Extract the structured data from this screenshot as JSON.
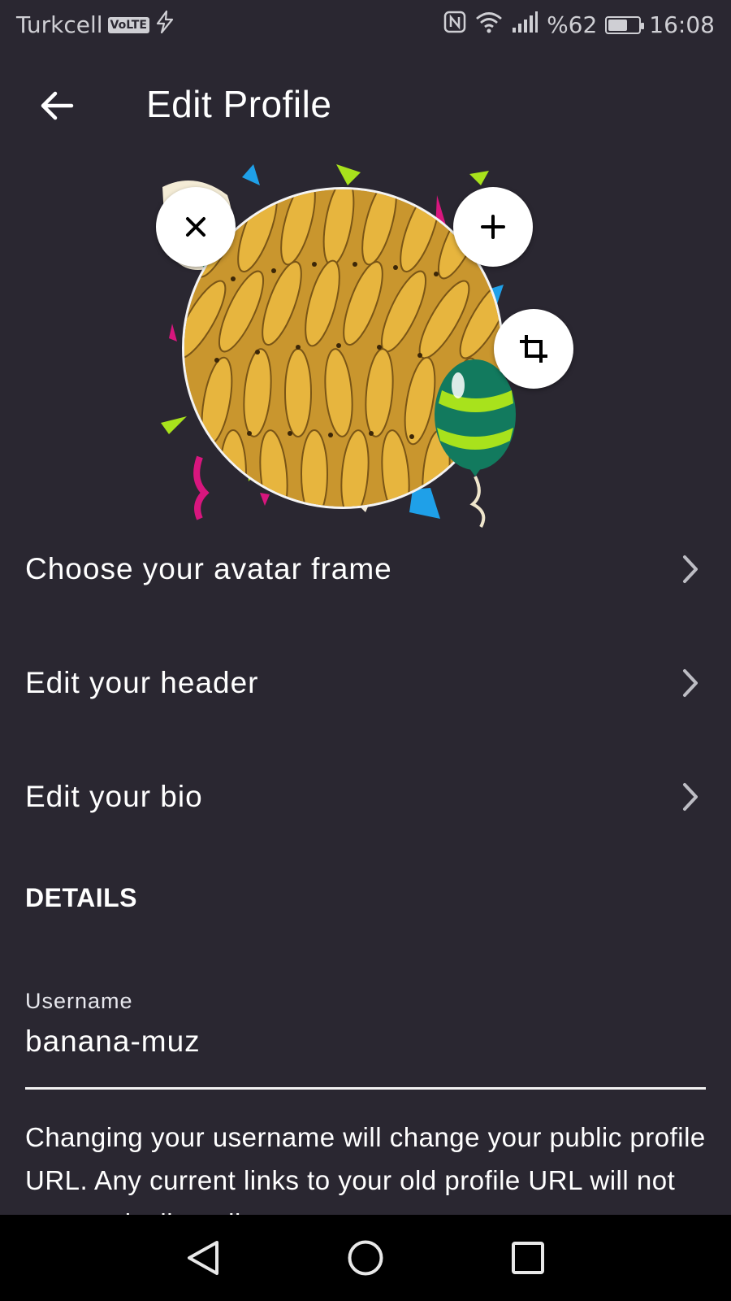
{
  "status_bar": {
    "carrier": "Turkcell",
    "volte": "VoLTE",
    "battery_text": "%62",
    "battery_level": 0.62,
    "time": "16:08"
  },
  "app_bar": {
    "title": "Edit Profile",
    "back_icon": "arrow-left-icon"
  },
  "avatar": {
    "remove_icon": "close-icon",
    "add_icon": "plus-icon",
    "crop_icon": "crop-icon"
  },
  "menu": [
    {
      "label": "Choose your avatar frame",
      "icon": "chevron-right-icon"
    },
    {
      "label": "Edit your header",
      "icon": "chevron-right-icon"
    },
    {
      "label": "Edit your bio",
      "icon": "chevron-right-icon"
    }
  ],
  "details": {
    "section_title": "DETAILS",
    "username_label": "Username",
    "username_value": "banana-muz",
    "help_text": "Changing your username will change your public profile URL. Any current links to your old profile URL will not automatically redirect to"
  },
  "nav_bar": {
    "back_icon": "triangle-back-icon",
    "home_icon": "circle-home-icon",
    "recents_icon": "square-recents-icon"
  },
  "colors": {
    "background": "#2a2731",
    "text": "#ffffff",
    "nav_background": "#000000"
  }
}
